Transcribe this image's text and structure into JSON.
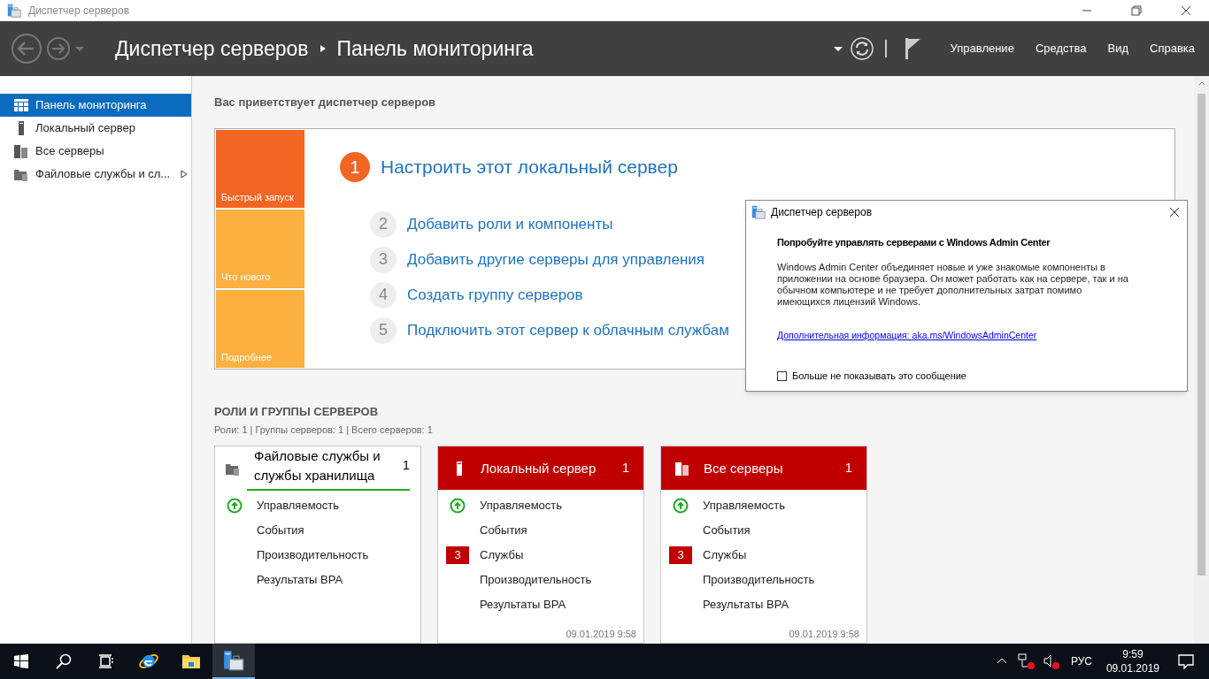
{
  "window": {
    "title": "Диспетчер серверов"
  },
  "header": {
    "breadcrumb": [
      "Диспетчер серверов",
      "Панель мониторинга"
    ],
    "menu": [
      "Управление",
      "Средства",
      "Вид",
      "Справка"
    ]
  },
  "sidebar": {
    "items": [
      {
        "label": "Панель мониторинга",
        "selected": true,
        "kind": "dashboard",
        "expandable": false
      },
      {
        "label": "Локальный сервер",
        "selected": false,
        "kind": "server",
        "expandable": false
      },
      {
        "label": "Все серверы",
        "selected": false,
        "kind": "servers",
        "expandable": false
      },
      {
        "label": "Файловые службы и сл...",
        "selected": false,
        "kind": "files",
        "expandable": true
      }
    ]
  },
  "welcome": {
    "title": "Вас приветствует диспетчер серверов",
    "quick_tiles": [
      {
        "label": "Быстрый запуск",
        "color": "#f26522"
      },
      {
        "label": "Что нового",
        "color": "#fbb040"
      },
      {
        "label": "Подробнее",
        "color": "#fbb040"
      }
    ],
    "steps": [
      {
        "number": "1",
        "label": "Настроить этот локальный сервер",
        "current": true
      },
      {
        "number": "2",
        "label": "Добавить роли и компоненты",
        "current": false
      },
      {
        "number": "3",
        "label": "Добавить другие серверы для управления",
        "current": false
      },
      {
        "number": "4",
        "label": "Создать группу серверов",
        "current": false
      },
      {
        "number": "5",
        "label": "Подключить этот сервер к облачным службам",
        "current": false
      }
    ]
  },
  "roles": {
    "title": "РОЛИ И ГРУППЫ СЕРВЕРОВ",
    "summary": "Роли: 1 | Группы серверов: 1 | Всего серверов: 1",
    "tiles": [
      {
        "kind": "files",
        "title": "Файловые службы и службы хранилища",
        "count": "1",
        "alert": false,
        "rows": [
          {
            "label": "Управляемость",
            "healthy": true
          },
          {
            "label": "События"
          },
          {
            "label": "Производительность"
          },
          {
            "label": "Результаты BPA"
          }
        ]
      },
      {
        "kind": "server",
        "title": "Локальный сервер",
        "count": "1",
        "alert": true,
        "timestamp": "09.01.2019 9:58",
        "rows": [
          {
            "label": "Управляемость",
            "healthy": true
          },
          {
            "label": "События"
          },
          {
            "label": "Службы",
            "badge": "3"
          },
          {
            "label": "Производительность"
          },
          {
            "label": "Результаты BPA"
          }
        ]
      },
      {
        "kind": "servers",
        "title": "Все серверы",
        "count": "1",
        "alert": true,
        "timestamp": "09.01.2019 9:58",
        "rows": [
          {
            "label": "Управляемость",
            "healthy": true
          },
          {
            "label": "События"
          },
          {
            "label": "Службы",
            "badge": "3"
          },
          {
            "label": "Производительность"
          },
          {
            "label": "Результаты BPA"
          }
        ]
      }
    ]
  },
  "dialog": {
    "title": "Диспетчер серверов",
    "heading": "Попробуйте управлять серверами с Windows Admin Center",
    "body": "Windows Admin Center объединяет новые и уже знакомые компоненты в приложении на основе браузера. Он может работать как на сервере, так и на обычном компьютере и не требует дополнительных затрат помимо имеющихся лицензий Windows.",
    "link": "Дополнительная информация: aka.ms/WindowsAdminCenter",
    "checkbox": {
      "label": "Больше не показывать это сообщение",
      "checked": false
    }
  },
  "taskbar": {
    "apps": [
      {
        "kind": "start",
        "selected": false
      },
      {
        "kind": "search",
        "selected": false
      },
      {
        "kind": "taskview",
        "selected": false
      },
      {
        "kind": "browser",
        "selected": false
      },
      {
        "kind": "folder",
        "selected": false
      },
      {
        "kind": "servermanager",
        "selected": true
      }
    ],
    "language": "РУС",
    "time": "9:59",
    "date": "09.01.2019"
  }
}
